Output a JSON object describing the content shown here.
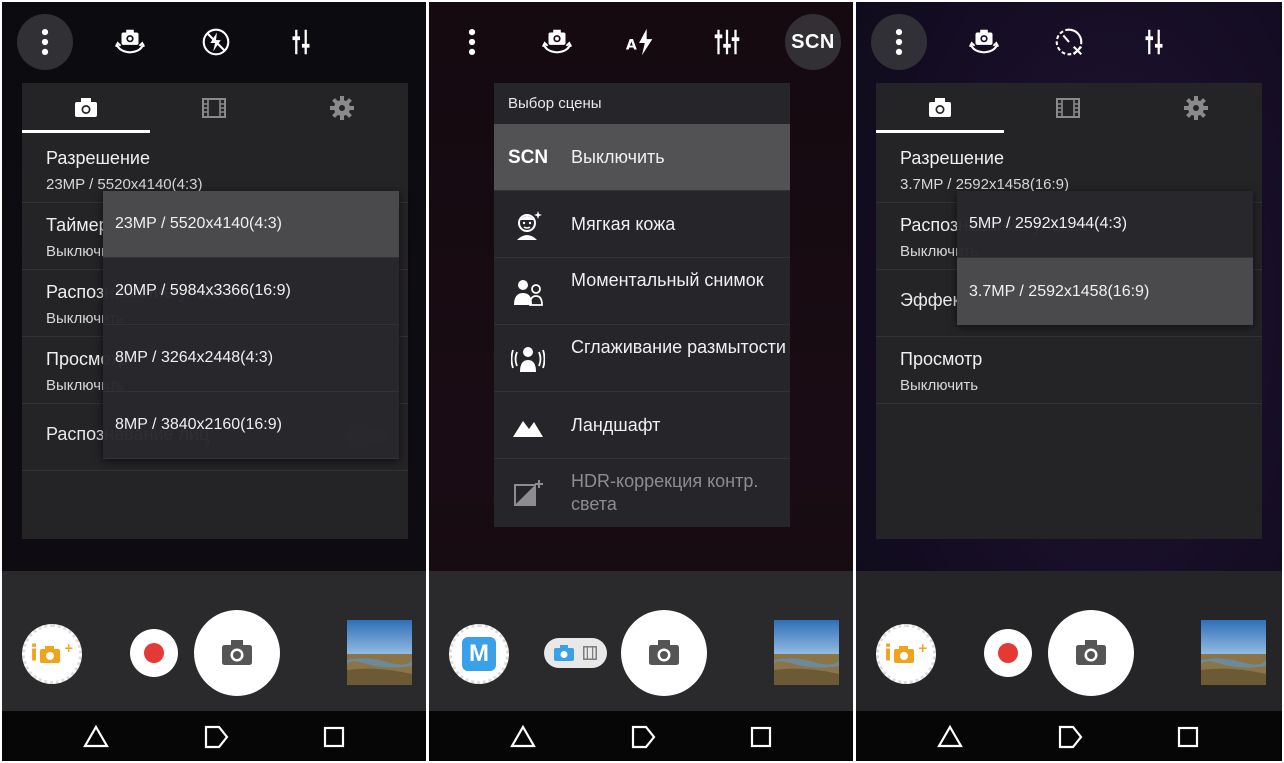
{
  "panel1": {
    "settings": [
      {
        "title": "Разрешение",
        "value": "23MP / 5520x4140(4:3)"
      },
      {
        "title": "Таймер",
        "value": "Выключить"
      },
      {
        "title": "Распознавание улыбки",
        "value": "Выключить"
      },
      {
        "title": "Просмотр",
        "value": "Выключить"
      },
      {
        "title": "Распознавание лиц"
      }
    ],
    "resolution_options": [
      "23MP / 5520x4140(4:3)",
      "20MP / 5984x3366(16:9)",
      "8MP / 3264x2448(4:3)",
      "8MP / 3840x2160(16:9)"
    ],
    "selected_option": "23MP / 5520x4140(4:3)"
  },
  "panel2": {
    "topbar_scn_label": "SCN",
    "scene_header": "Выбор сцены",
    "scenes": [
      {
        "icon": "scn-text",
        "icon_text": "SCN",
        "label": "Выключить",
        "selected": true
      },
      {
        "icon": "soft-skin-icon",
        "label": "Мягкая кожа"
      },
      {
        "icon": "instant-shot-icon",
        "label": "Моментальный снимок"
      },
      {
        "icon": "blur-reduction-icon",
        "label": "Сглаживание размытости"
      },
      {
        "icon": "landscape-icon",
        "label": "Ландшафт"
      },
      {
        "icon": "hdr-backlight-icon",
        "label": "HDR-коррекция контр. света",
        "dim": true
      }
    ],
    "mode_badge": "M"
  },
  "panel3": {
    "settings": [
      {
        "title": "Разрешение",
        "value": "3.7MP / 2592x1458(16:9)"
      },
      {
        "title": "Распознавание улыбки",
        "value": "Выключить"
      },
      {
        "title": "Эффект мягкой кожи"
      },
      {
        "title": "Просмотр",
        "value": "Выключить"
      }
    ],
    "resolution_options": [
      "5MP / 2592x1944(4:3)",
      "3.7MP / 2592x1458(16:9)"
    ],
    "selected_option": "3.7MP / 2592x1458(16:9)"
  },
  "colors": {
    "record": "#e53935",
    "accent_blue": "#3aa0e8",
    "superior_auto": "#f0a31c"
  }
}
